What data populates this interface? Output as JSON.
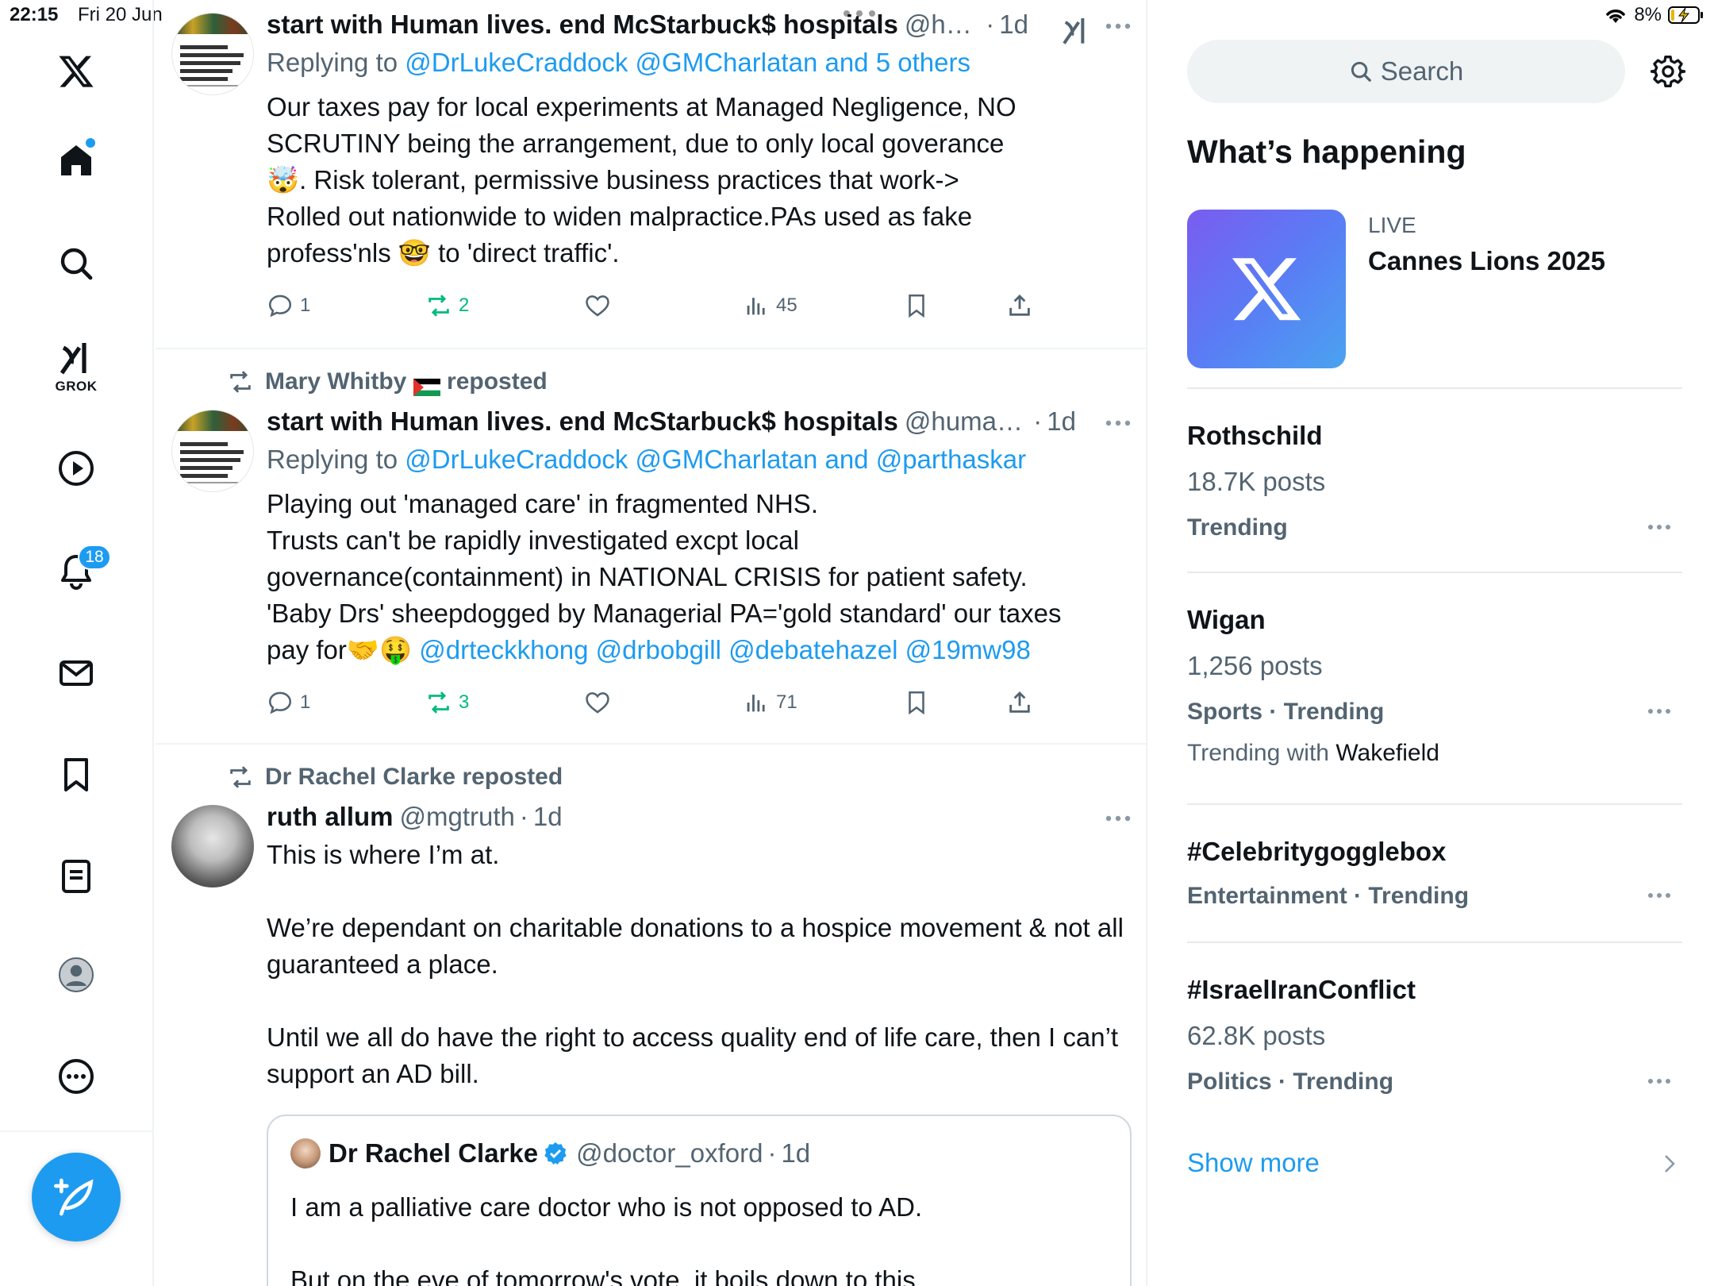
{
  "status_bar": {
    "time": "22:15",
    "date": "Fri 20 Jun",
    "battery": "8%"
  },
  "nav": {
    "grok_label": "GROK",
    "notifications_badge": "18"
  },
  "tweets": [
    {
      "author": "start with Human lives. end McStarbuck$ hospitals",
      "handle": "@hu...",
      "time": "1d",
      "reply_prefix": "Replying to",
      "reply_mentions": "@DrLukeCraddock @GMCharlatan and 5 others",
      "body": "Our taxes pay for local experiments at Managed Negligence, NO SCRUTINY being the arrangement, due to only local goverance🤯. Risk tolerant, permissive business practices that work->\nRolled out nationwide to widen malpractice.PAs used as fake profess'nls 🤓 to 'direct traffic'.",
      "replies": "1",
      "reposts": "2",
      "views": "45"
    },
    {
      "reposted_by": "Mary Whitby",
      "reposted_label": "reposted",
      "author": "start with Human lives. end McStarbuck$ hospitals",
      "handle": "@human...",
      "time": "1d",
      "reply_prefix": "Replying to",
      "reply_mentions": "@DrLukeCraddock @GMCharlatan and @parthaskar",
      "body": "Playing out 'managed care' in fragmented NHS.\nTrusts can't be rapidly investigated excpt local governance(containment) in NATIONAL CRISIS for patient safety. 'Baby Drs' sheepdogged by Managerial PA='gold standard' our taxes pay for🤝🤑 ",
      "body_mentions": "@drteckkhong @drbobgill @debatehazel @19mw98",
      "replies": "1",
      "reposts": "3",
      "views": "71"
    },
    {
      "reposted_by": "Dr Rachel Clarke reposted",
      "author": "ruth allum",
      "handle": "@mgtruth",
      "time": "1d",
      "body": "This is where I’m at.\n\nWe’re dependant on charitable donations to a hospice movement & not all guaranteed a place.\n\nUntil we all do have the right to access quality end of life care, then I can’t support an AD bill.",
      "quote": {
        "author": "Dr Rachel Clarke",
        "handle": "@doctor_oxford",
        "time": "1d",
        "body": "I am a palliative care doctor who is not opposed to AD.\n\nBut on the eve of tomorrow's vote, it boils down to this."
      }
    }
  ],
  "sidebar": {
    "search_placeholder": "Search",
    "title": "What’s happening",
    "live": {
      "label": "LIVE",
      "title": "Cannes Lions 2025"
    },
    "trends": [
      {
        "topic": "Rothschild",
        "posts": "18.7K posts",
        "meta": "Trending"
      },
      {
        "topic": "Wigan",
        "posts": "1,256 posts",
        "meta": "Sports · Trending",
        "with_prefix": "Trending with",
        "with_term": "Wakefield"
      },
      {
        "topic": "#Celebritygogglebox",
        "meta": "Entertainment · Trending"
      },
      {
        "topic": "#IsraelIranConflict",
        "posts": "62.8K posts",
        "meta": "Politics · Trending"
      }
    ],
    "show_more": "Show more"
  },
  "colors": {
    "accent": "#1d9bf0",
    "repost_green": "#00ba7c",
    "secondary_text": "#536471"
  }
}
